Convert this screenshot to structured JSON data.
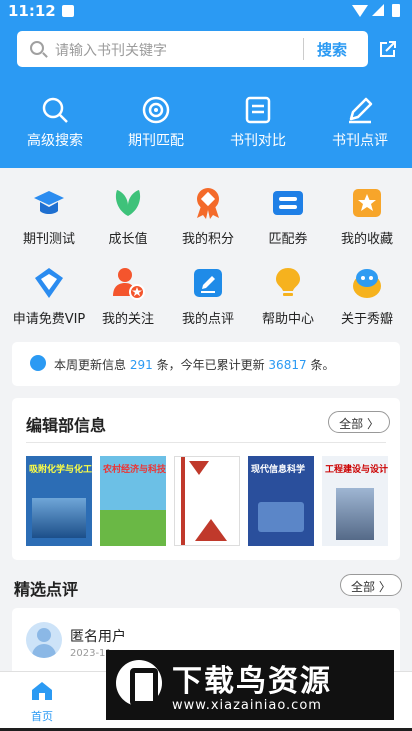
{
  "status_bar": {
    "time": "11:12"
  },
  "search": {
    "placeholder": "请输入书刊关键字",
    "button_label": "搜索"
  },
  "top_nav": [
    {
      "label": "高级搜索",
      "icon": "search-icon"
    },
    {
      "label": "期刊匹配",
      "icon": "target-icon"
    },
    {
      "label": "书刊对比",
      "icon": "document-icon"
    },
    {
      "label": "书刊点评",
      "icon": "pencil-icon"
    }
  ],
  "features": [
    {
      "label": "期刊测试",
      "icon": "graduation-cap-icon",
      "color": "#2b8cf0"
    },
    {
      "label": "成长值",
      "icon": "leaf-icon",
      "color": "#3ec27a"
    },
    {
      "label": "我的积分",
      "icon": "medal-icon",
      "color": "#f46a2a"
    },
    {
      "label": "匹配券",
      "icon": "ticket-icon",
      "color": "#1f7fe6"
    },
    {
      "label": "我的收藏",
      "icon": "star-box-icon",
      "color": "#f7a52a"
    },
    {
      "label": "申请免费VIP",
      "icon": "vip-diamond-icon",
      "color": "#2b8cf0"
    },
    {
      "label": "我的关注",
      "icon": "user-star-icon",
      "color": "#f4552d"
    },
    {
      "label": "我的点评",
      "icon": "edit-box-icon",
      "color": "#1f8be8"
    },
    {
      "label": "帮助中心",
      "icon": "lightbulb-icon",
      "color": "#f6b21e"
    },
    {
      "label": "关于秀瓣",
      "icon": "mascot-icon",
      "color": "#2f9bf2"
    }
  ],
  "notice": {
    "prefix": "本周更新信息",
    "week_count": "291",
    "middle": "条，今年已累计更新",
    "year_count": "36817",
    "suffix": "条。"
  },
  "editorial": {
    "title": "编辑部信息",
    "all_label": "全部 〉",
    "covers": [
      {
        "text": "吸附化学与化工"
      },
      {
        "text": "农村经济与科技"
      },
      {
        "text": ""
      },
      {
        "text": "现代信息科学"
      },
      {
        "text": "工程建设与设计"
      }
    ]
  },
  "picks": {
    "title": "精选点评",
    "all_label": "全部 〉",
    "user_name": "匿名用户",
    "date": "2023-11"
  },
  "tabbar": {
    "home_label": "首页"
  },
  "watermark": {
    "title": "下载鸟资源",
    "url": "www.xiazainiao.com"
  }
}
